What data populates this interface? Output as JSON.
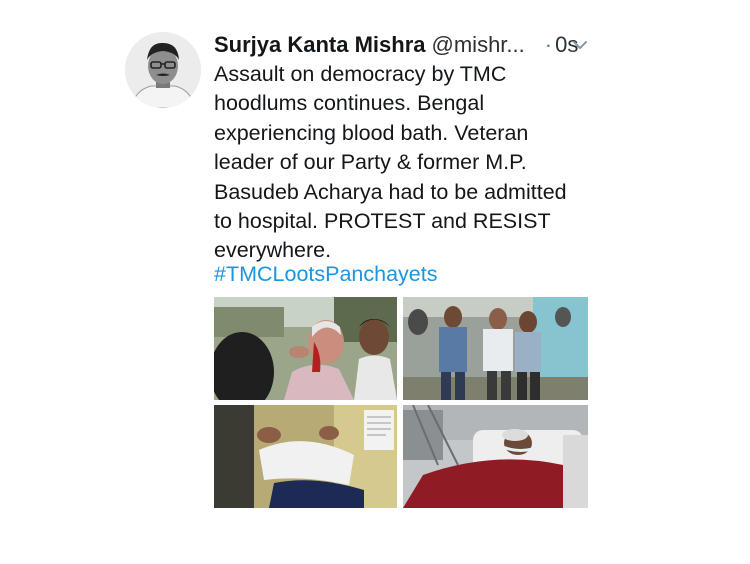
{
  "tweet": {
    "author": {
      "name": "Surjya Kanta Mishra",
      "handle": "@mishr...",
      "avatar": "author-avatar"
    },
    "separator": "·",
    "timestamp": "0s",
    "menu_icon": "chevron-down-icon",
    "body_lines": [
      "Assault on democracy by TMC",
      "hoodlums continues. Bengal",
      "experiencing blood bath. Veteran",
      "leader of our Party & former M.P.",
      "Basudeb Acharya had to be admitted",
      "to hospital. PROTEST and RESIST",
      "everywhere."
    ],
    "hashtag": "#TMCLootsPanchayets",
    "photos": [
      "injured-man-bleeding-photo",
      "men-helping-injured-man-walk-photo",
      "patient-lying-on-bed-photo",
      "patient-in-hospital-bed-photo"
    ],
    "colors": {
      "link": "#1b95e0",
      "text": "#14171a",
      "muted": "#657786"
    }
  }
}
